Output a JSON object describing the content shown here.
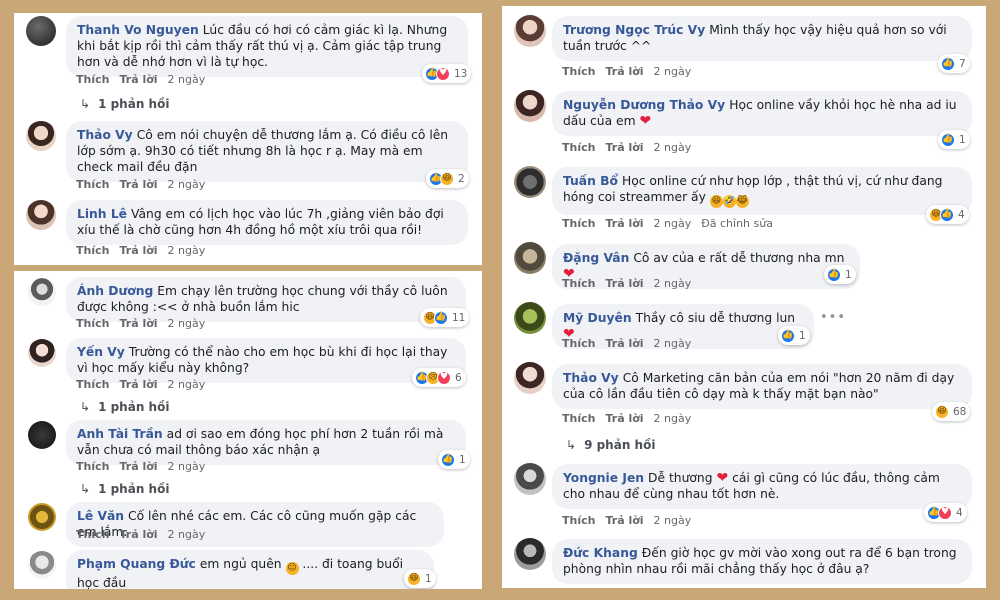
{
  "labels": {
    "like": "Thích",
    "reply": "Trả lời"
  },
  "panel_a": {
    "comments": [
      {
        "author": "Thanh Vo Nguyen",
        "text": "Lúc đầu có hơi có cảm giác kì lạ. Nhưng khi bắt kịp rồi thì cảm thấy rất thú vị ạ. Cảm giác tập trung hơn và dễ nhớ hơn vì là tự học.",
        "time": "2 ngày",
        "reaction_count": "13",
        "replies": "1 phản hồi"
      },
      {
        "author": "Thảo Vy",
        "text": "Cô em nói chuyện dễ thương lắm ạ. Có điều cô lên lớp sớm ạ. 9h30 có tiết nhưng 8h là học r ạ. May mà em check mail đều đặn",
        "time": "2 ngày",
        "reaction_count": "2"
      },
      {
        "author": "Linh Lê",
        "text": "Vâng em có lịch học vào lúc 7h ,giảng viên bảo đợi xíu thế là chờ cũng hơn 4h đồng hồ một xíu trôi qua rồi!",
        "time": "2 ngày"
      }
    ]
  },
  "panel_b": {
    "comments": [
      {
        "author": "Ánh Dương",
        "text": "Em chạy lên trường học chung với thầy cô luôn được không :<< ở nhà buồn lắm hic",
        "time": "2 ngày",
        "reaction_count": "11"
      },
      {
        "author": "Yến Vy",
        "text": "Trường có thể nào cho em học bù khi đi học lại thay vì học mấy kiểu này không?",
        "time": "2 ngày",
        "reaction_count": "6",
        "replies": "1 phản hồi"
      },
      {
        "author": "Anh Tài Trần",
        "text": "ad ơi sao em đóng học phí hơn 2 tuần rồi mà vẫn chưa có mail thông báo xác nhận ạ",
        "time": "2 ngày",
        "reaction_count": "1",
        "replies": "1 phản hồi"
      },
      {
        "author": "Lê Văn",
        "text": "Cố lên nhé các em. Các cô cũng muốn gặp các em lắm.",
        "time": "2 ngày"
      },
      {
        "author": "Phạm Quang Đức",
        "text": "em ngủ quên",
        "text2": ".... đi toang buổi học đầu",
        "time": "2 ngày",
        "reaction_count": "1"
      }
    ]
  },
  "panel_c": {
    "comments": [
      {
        "author": "Trương Ngọc Trúc Vy",
        "text": "Mình thấy học vậy hiệu quả hơn so với tuần trước ^^",
        "time": "2 ngày",
        "reaction_count": "7"
      },
      {
        "author": "Nguyễn Dương Thảo Vy",
        "text": "Học online vầy khỏi học hè nha ad iu dấu của em",
        "time": "2 ngày",
        "reaction_count": "1"
      },
      {
        "author": "Tuấn Bổ",
        "text": "Học online cứ như họp lớp , thật thú vị, cứ như đang hóng coi streammer ấy",
        "time": "2 ngày",
        "edited": "Đã chỉnh sửa",
        "reaction_count": "4"
      },
      {
        "author": "Đặng Vân",
        "text": "Cô av của e rất dễ thương nha mn",
        "time": "2 ngày",
        "reaction_count": "1"
      },
      {
        "author": "Mỹ Duyên",
        "text": "Thầy cô siu dễ thương lun",
        "time": "2 ngày",
        "reaction_count": "1"
      },
      {
        "author": "Thảo Vy",
        "text": "Cô Marketing căn bản của em nói \"hơn 20 năm đi dạy của cô lần đầu tiên cô dạy mà k thấy mặt bạn nào\"",
        "time": "2 ngày",
        "reaction_count": "68",
        "replies": "9 phản hồi"
      },
      {
        "author": "Yongnie Jen",
        "text": "Dễ thương",
        "text2": "cái gì cũng có lúc đầu, thông cảm cho nhau để cùng nhau tốt hơn nè.",
        "time": "2 ngày",
        "reaction_count": "4"
      },
      {
        "author": "Đức Khang",
        "text": "Đến giờ học gv mời vào xong out ra để 6 bạn trong phòng nhìn nhau rồi mãi chẳng thấy học ở đâu ạ?"
      }
    ]
  },
  "icons": [
    "like-icon",
    "love-icon",
    "haha-icon",
    "sad-icon",
    "reply-arrow-icon",
    "more-options-icon"
  ],
  "colors": {
    "background": "#c9a777",
    "author": "#385898",
    "bubble": "#f0f2f5",
    "like": "#1877f2",
    "love": "#f33e58"
  }
}
